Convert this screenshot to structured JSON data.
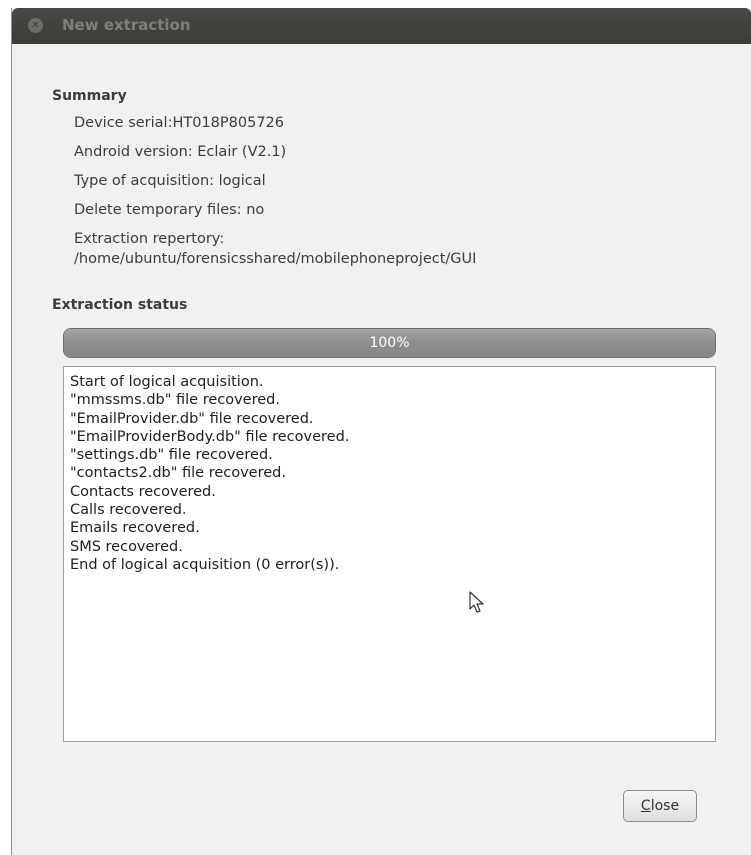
{
  "window": {
    "title": "New extraction",
    "close_icon": "close-icon"
  },
  "summary": {
    "heading": "Summary",
    "lines": [
      "Device serial:HT018P805726",
      "Android version: Eclair (V2.1)",
      "Type of acquisition: logical",
      "Delete temporary files: no",
      "Extraction repertory:",
      "/home/ubuntu/forensicsshared/mobilephoneproject/GUI"
    ]
  },
  "extraction_status": {
    "heading": "Extraction status",
    "progress_percent": 100,
    "progress_label": "100%",
    "log": [
      "Start of logical acquisition.",
      "\"mmssms.db\" file recovered.",
      "\"EmailProvider.db\" file recovered.",
      "\"EmailProviderBody.db\" file recovered.",
      "\"settings.db\" file recovered.",
      "\"contacts2.db\" file recovered.",
      "Contacts recovered.",
      "Calls recovered.",
      "Emails recovered.",
      "SMS recovered.",
      "End of logical acquisition (0 error(s))."
    ]
  },
  "buttons": {
    "close_label": "Close"
  },
  "colors": {
    "titlebar": "#3c3b37",
    "window_bg": "#f2f1f0",
    "progress_fill": "#8e8e8e"
  }
}
